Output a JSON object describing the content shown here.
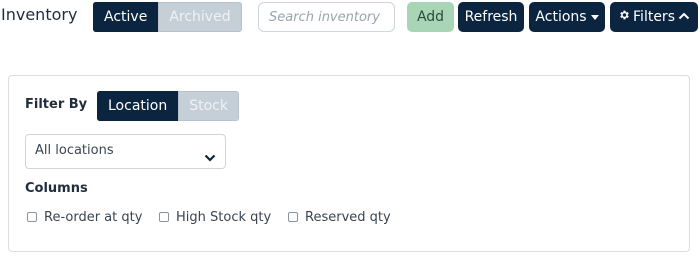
{
  "header": {
    "title": "Inventory",
    "status_tabs": [
      {
        "label": "Active",
        "selected": true
      },
      {
        "label": "Archived",
        "selected": false
      }
    ],
    "search": {
      "placeholder": "Search inventory",
      "value": ""
    },
    "buttons": {
      "add": "Add",
      "refresh": "Refresh",
      "actions": "Actions",
      "filters": "Filters"
    },
    "icons": {
      "actions": "caret-down-icon",
      "filters_left": "gear-icon",
      "filters_right": "chevron-up-icon"
    }
  },
  "filter_panel": {
    "filter_by_label": "Filter By",
    "filter_tabs": [
      {
        "label": "Location",
        "selected": true
      },
      {
        "label": "Stock",
        "selected": false
      }
    ],
    "location_select": {
      "value": "All locations",
      "icon": "chevron-down-icon"
    },
    "columns_label": "Columns",
    "columns": [
      {
        "label": "Re-order at qty",
        "checked": false
      },
      {
        "label": "High Stock qty",
        "checked": false
      },
      {
        "label": "Reserved qty",
        "checked": false
      }
    ]
  },
  "colors": {
    "primary": "#0b2540",
    "inactive": "#c5cfd7",
    "add_button": "#a8d5b5",
    "panel_border": "#d9dee3"
  }
}
